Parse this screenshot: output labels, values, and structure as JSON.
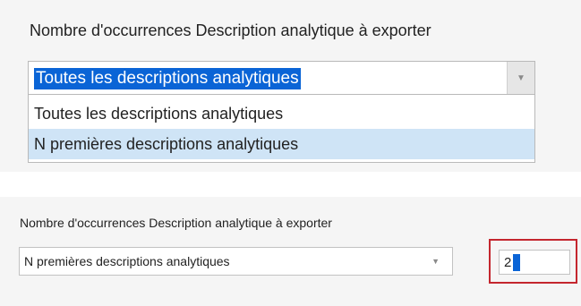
{
  "expanded_view": {
    "label": "Nombre d'occurrences Description analytique à exporter",
    "combo_selected": "Toutes les descriptions analytiques",
    "options": [
      "Toutes les descriptions analytiques",
      "N premières descriptions analytiques"
    ],
    "hovered_option_index": 1
  },
  "collapsed_view": {
    "label": "Nombre d'occurrences Description analytique à exporter",
    "combo_value": "N premières descriptions analytiques",
    "count_value": "2"
  },
  "colors": {
    "selection": "#0a64d6",
    "hover": "#cfe4f6",
    "highlight_border": "#c4262e"
  },
  "icons": [
    "dropdown-arrow-icon"
  ]
}
